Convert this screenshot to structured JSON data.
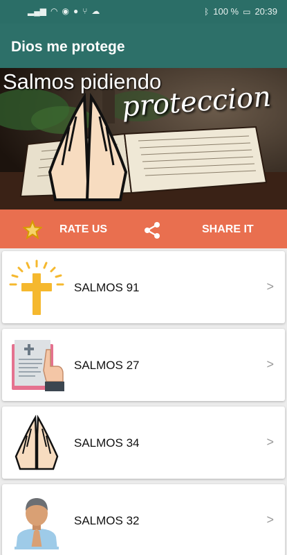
{
  "status_bar": {
    "battery": "100 %",
    "time": "20:39"
  },
  "app_bar": {
    "title": "Dios me protege"
  },
  "hero": {
    "line1": "Salmos pidiendo",
    "line2": "proteccion"
  },
  "actions": {
    "rate_label": "RATE US",
    "share_label": "SHARE IT",
    "accent_color": "#e96f4f"
  },
  "psalms": [
    {
      "label": "SALMOS 91",
      "icon": "cross-icon",
      "chevron": ">"
    },
    {
      "label": "SALMOS 27",
      "icon": "bible-hand-icon",
      "chevron": ">"
    },
    {
      "label": "SALMOS 34",
      "icon": "praying-hands-icon",
      "chevron": ">"
    },
    {
      "label": "SALMOS 32",
      "icon": "praying-man-icon",
      "chevron": ">"
    }
  ]
}
